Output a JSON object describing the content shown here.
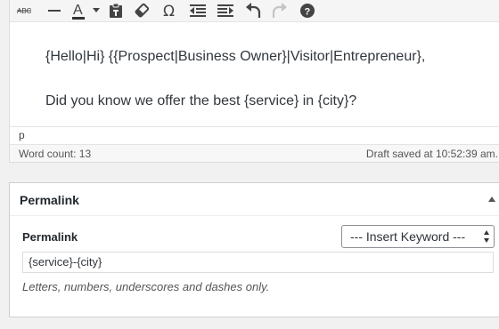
{
  "toolbar": {
    "icons": [
      "strikethrough-icon",
      "horizontal-line-icon",
      "text-color-icon",
      "dropdown-caret-icon",
      "paste-as-text-icon",
      "clear-formatting-icon",
      "special-character-icon",
      "outdent-icon",
      "indent-icon",
      "undo-icon",
      "redo-icon",
      "help-icon"
    ],
    "strike_label": "ABC",
    "text_color_letter": "A",
    "omega_glyph": "Ω",
    "help_glyph": "?"
  },
  "editor": {
    "line1": "{Hello|Hi} {{Prospect|Business Owner}|Visitor|Entrepreneur},",
    "line2": "Did you know we offer the best {service} in {city}?"
  },
  "pathbar": {
    "path": "p"
  },
  "status": {
    "word_count": "Word count: 13",
    "draft_saved": "Draft saved at 10:52:39 am."
  },
  "permalink_box": {
    "title": "Permalink",
    "field_label": "Permalink",
    "select_value": "--- Insert Keyword ---",
    "input_value": "{service}-{city}",
    "help_text": "Letters, numbers, underscores and dashes only."
  },
  "colors": {
    "text_color_underline": "#333333",
    "toolbar_icon": "#444444",
    "redo_disabled": "#c3c4c7"
  }
}
